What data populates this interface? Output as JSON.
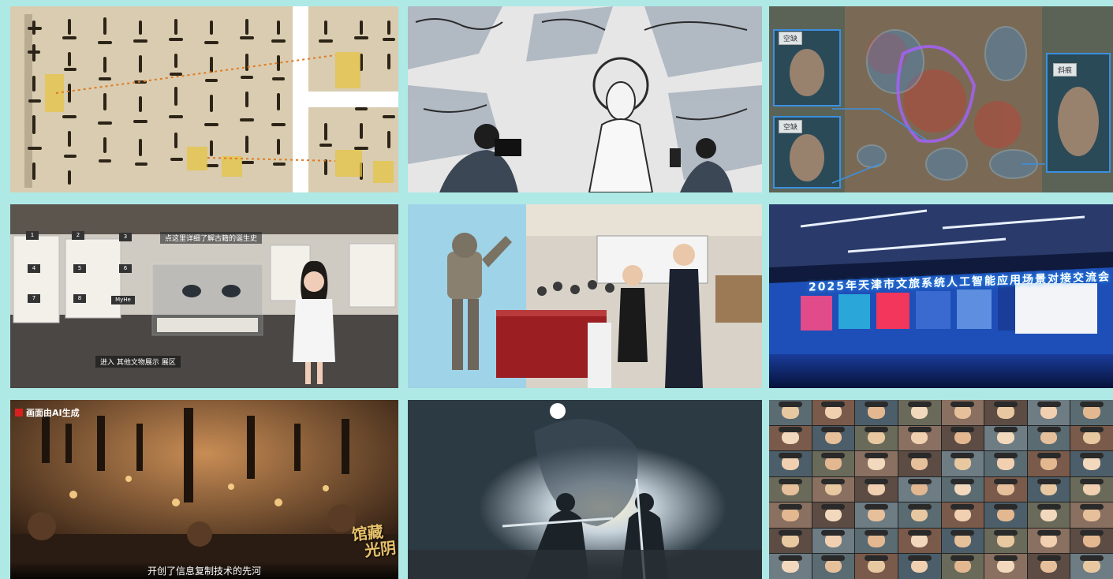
{
  "tiles": {
    "manuscript": {
      "label": "manuscript-tile"
    },
    "mural_sketch": {
      "label": "mural-sketch-tile"
    },
    "mural_scan": {
      "label_top": "空缺",
      "label_mid": "空缺",
      "label_right": "斜痕"
    },
    "virtual_museum": {
      "tip": "点这里详细了解古籍的诞生史",
      "nav": "进入  其他文物展示  展区",
      "buttons": [
        "1",
        "2",
        "3",
        "4",
        "5",
        "6",
        "7",
        "8"
      ],
      "myhe": "MyHe"
    },
    "robot_event": {
      "label": "robot-event-tile"
    },
    "conference": {
      "banner": "2025年天津市文旅系统人工智能应用场景对接交流会"
    },
    "ai_workshop": {
      "badge": "画面由AI生成",
      "title_line1": "馆藏",
      "title_line2": "光阴",
      "caption": "开创了信息复制技术的先河"
    },
    "warrior": {
      "label": "warrior-tile"
    },
    "portraits": {
      "count": 56
    }
  },
  "colors": {
    "background": "#aee9e6",
    "manuscript_paper": "#d9ccb0",
    "highlight": "#e6c445",
    "scan_blue": "#3c8fe0",
    "conference_blue": "#1a3d9a"
  }
}
